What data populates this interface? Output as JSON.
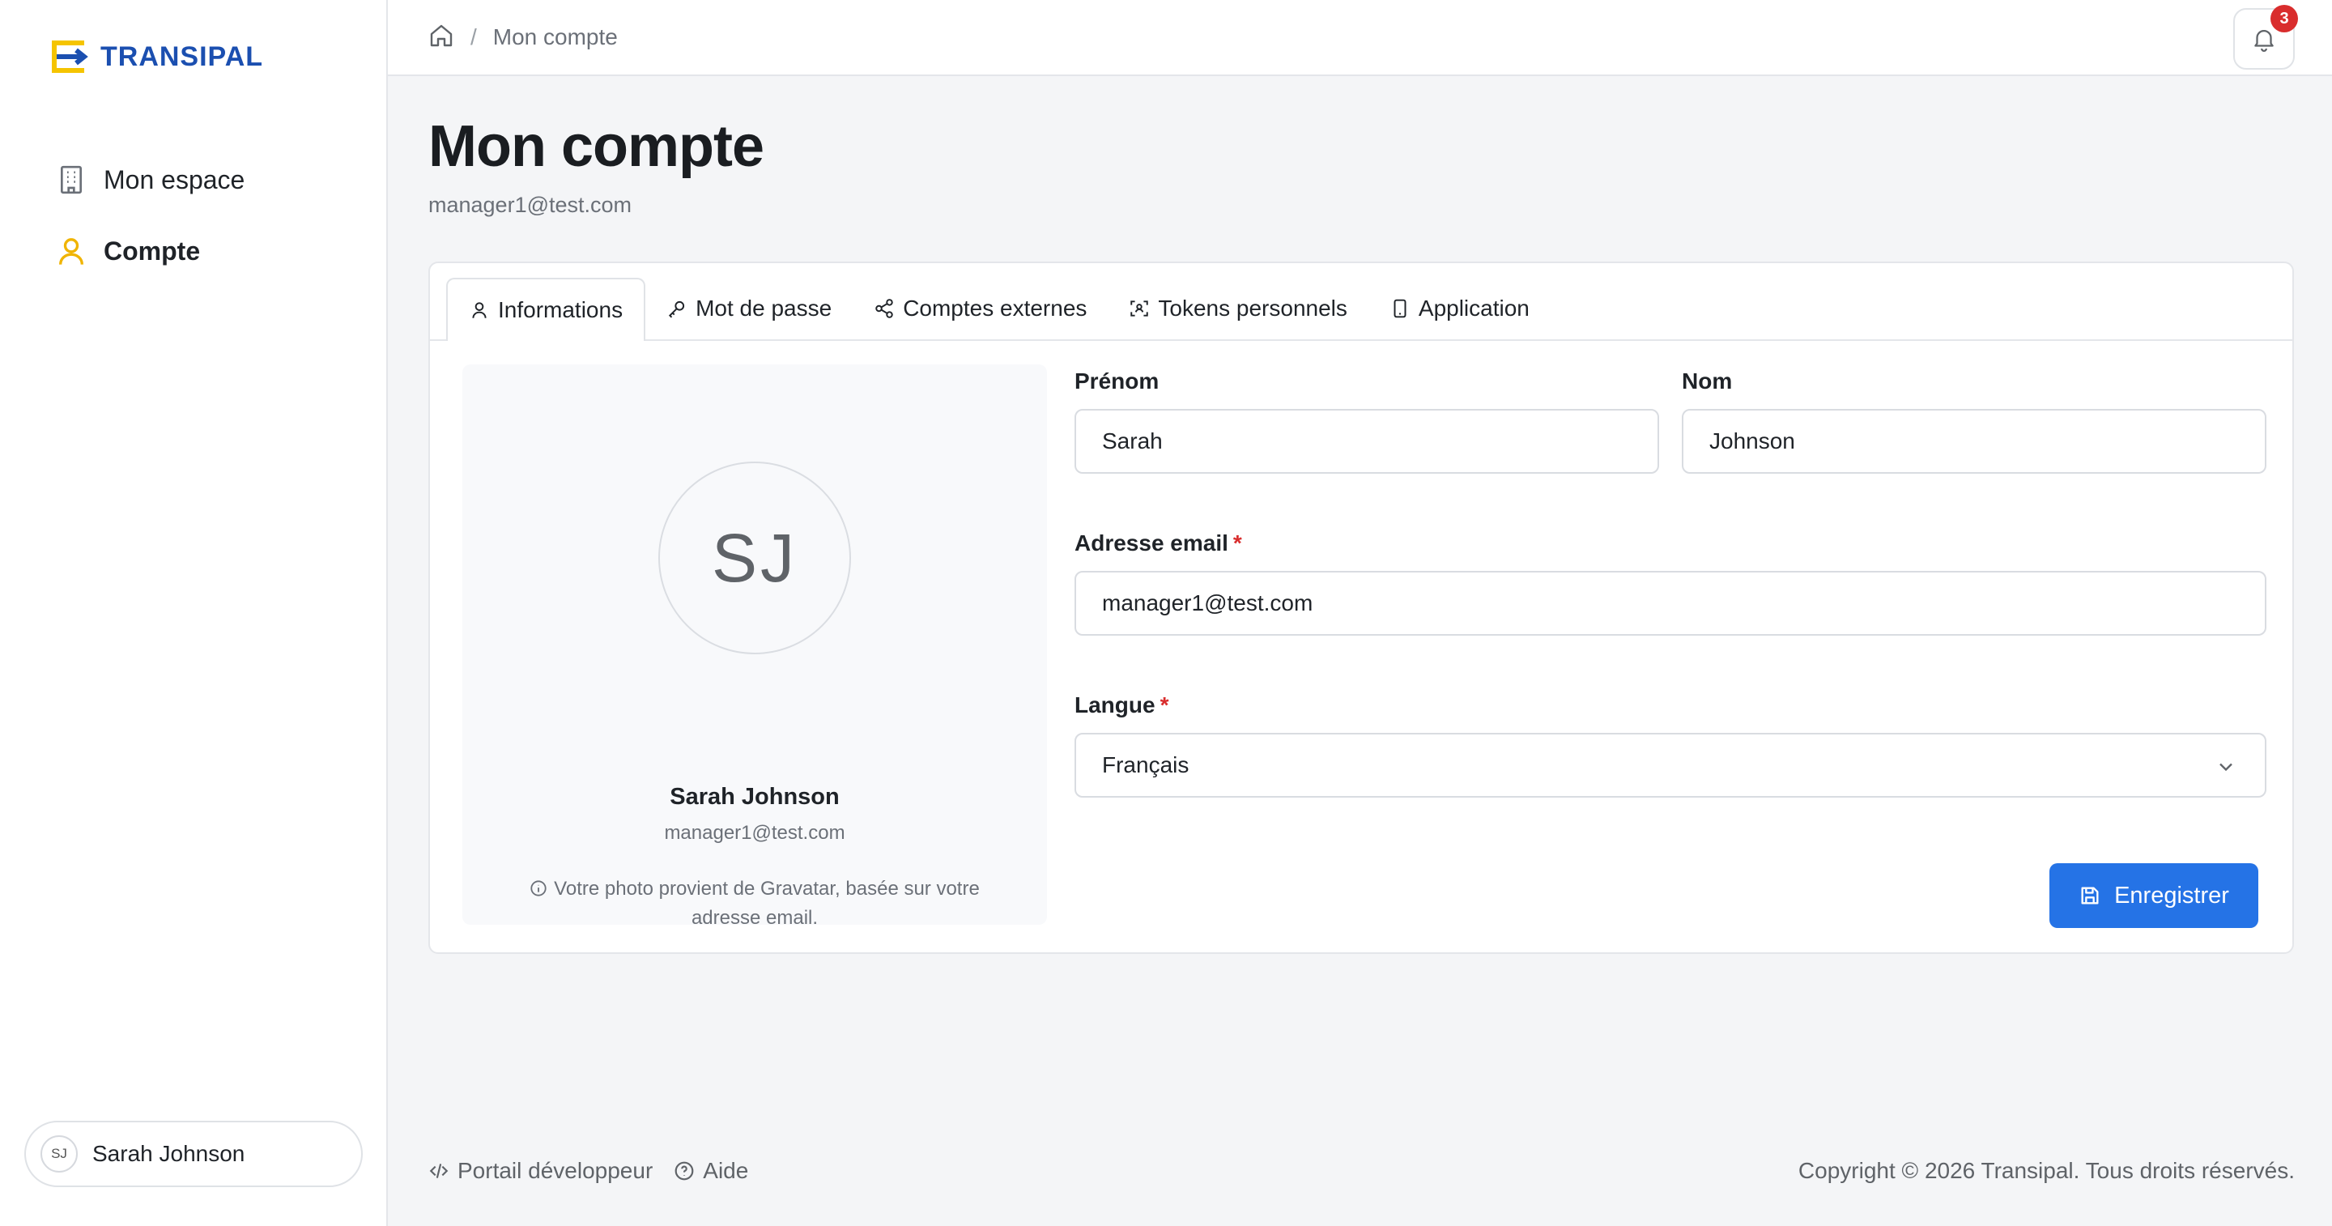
{
  "brand": {
    "name": "TRANSIPAL",
    "primary": "#1b4fb0",
    "accent": "#f5c400"
  },
  "sidebar": {
    "items": [
      {
        "label": "Mon espace",
        "icon": "building-icon",
        "active": false
      },
      {
        "label": "Compte",
        "icon": "user-icon",
        "active": true
      }
    ],
    "user": {
      "initials": "SJ",
      "name": "Sarah Johnson"
    }
  },
  "topbar": {
    "breadcrumb_separator": "/",
    "breadcrumb_current": "Mon compte",
    "notifications_count": "3"
  },
  "page": {
    "title": "Mon compte",
    "subtitle": "manager1@test.com"
  },
  "tabs": [
    {
      "label": "Informations",
      "icon": "user-icon",
      "active": true
    },
    {
      "label": "Mot de passe",
      "icon": "key-icon",
      "active": false
    },
    {
      "label": "Comptes externes",
      "icon": "share-icon",
      "active": false
    },
    {
      "label": "Tokens personnels",
      "icon": "scan-icon",
      "active": false
    },
    {
      "label": "Application",
      "icon": "phone-icon",
      "active": false
    }
  ],
  "profile": {
    "initials": "SJ",
    "name": "Sarah Johnson",
    "email": "manager1@test.com",
    "note": "Votre photo provient de Gravatar, basée sur votre adresse email."
  },
  "form": {
    "first_name": {
      "label": "Prénom",
      "value": "Sarah"
    },
    "last_name": {
      "label": "Nom",
      "value": "Johnson"
    },
    "email": {
      "label": "Adresse email",
      "required_mark": "*",
      "value": "manager1@test.com"
    },
    "language": {
      "label": "Langue",
      "required_mark": "*",
      "value": "Français"
    },
    "save_label": "Enregistrer",
    "save_color": "#2573e6"
  },
  "footer": {
    "dev_portal": "Portail développeur",
    "help": "Aide",
    "copyright": "Copyright © 2026 Transipal. Tous droits réservés."
  }
}
